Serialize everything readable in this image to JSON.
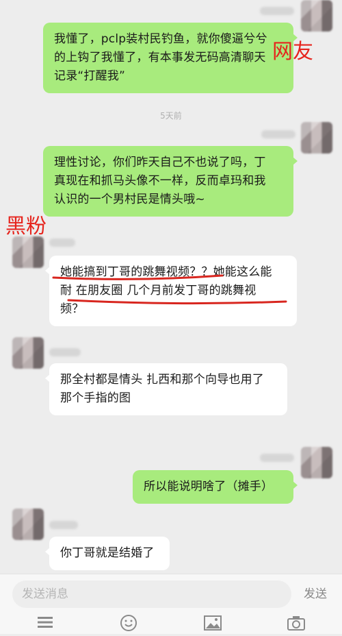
{
  "conversation": {
    "timestamp": "5天前",
    "messages": [
      {
        "side": "right",
        "text_lines": [
          "我懂了，pclp装村民钓鱼，就你傻逼兮兮",
          "的上钩了我懂了，有本事发无码高清聊天",
          "记录“打醒我”"
        ]
      },
      {
        "side": "right",
        "text_lines": [
          "理性讨论，你们昨天自己不也说了吗，丁",
          "真现在和抓马头像不一样，反而卓玛和我",
          "认识的一个男村民是情头哦~"
        ]
      },
      {
        "side": "left",
        "text_lines": [
          "她能搞到丁哥的跳舞视频？？她能这么能",
          "耐 在朋友圈 几个月前发丁哥的跳舞视",
          "频？"
        ]
      },
      {
        "side": "left",
        "text_lines": [
          "那全村都是情头 扎西和那个向导也用了",
          "那个手指的图"
        ]
      },
      {
        "side": "right",
        "text_lines": [
          "所以能说明啥了（摊手）"
        ]
      },
      {
        "side": "left",
        "text_lines": [
          "你丁哥就是结婚了"
        ]
      }
    ]
  },
  "annotations": {
    "netizen_label": "网友",
    "hater_label": "黑粉",
    "underline_color": "#d8261f"
  },
  "input_bar": {
    "placeholder": "发送消息",
    "send_label": "发送"
  }
}
